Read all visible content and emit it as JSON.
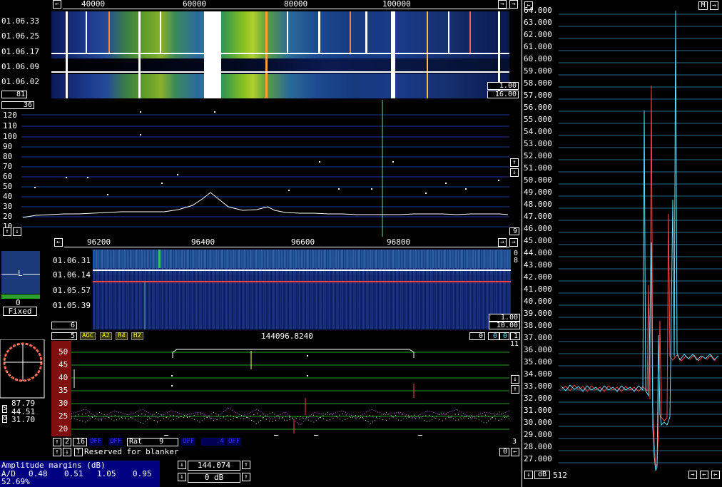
{
  "top_waterfall": {
    "freq_labels": [
      "40000",
      "60000",
      "80000",
      "100000"
    ],
    "time_labels": [
      "01.06.33",
      "01.06.25",
      "01.06.17",
      "01.06.09",
      "01.06.02"
    ],
    "left_box": "81",
    "right_box_1": "1.00",
    "right_box_2": "16.00"
  },
  "top_spectrum": {
    "top_left_box": "36",
    "y_labels": [
      "120",
      "110",
      "100",
      "90",
      "80",
      "70",
      "60",
      "50",
      "40",
      "30",
      "20",
      "10"
    ],
    "bottom_right_box": "9"
  },
  "small_rx": {
    "label_L": "L",
    "value": "0",
    "mode": "Fixed"
  },
  "mid_waterfall": {
    "freq_labels": [
      "96200",
      "96400",
      "96600",
      "96800"
    ],
    "time_labels": [
      "01.06.31",
      "01.06.14",
      "01.05.57",
      "01.05.39"
    ],
    "right_top_1": "0",
    "right_top_2": "8",
    "right_box_1": "1.00",
    "right_box_2": "10.00",
    "left_box": "6"
  },
  "baseband": {
    "left_box": "5",
    "tags": [
      "AGC",
      "A2",
      "R4",
      "H2"
    ],
    "frequency": "144096.8240",
    "right_boxes": [
      "0",
      "0",
      "0",
      "1"
    ],
    "right_num": "11",
    "y_labels": [
      "50",
      "45",
      "40",
      "35",
      "30",
      "25",
      "20"
    ],
    "row1_left": [
      "2",
      "16"
    ],
    "row1_tags": [
      "OFF",
      "OFF"
    ],
    "rat_label": "Rat",
    "rat_value": "9",
    "row1_tags2": [
      "OFF",
      "4",
      "OFF"
    ],
    "right_small": "3",
    "blanker_text": "Reserved for blanker",
    "bottom_right": "0"
  },
  "polar": {
    "s_value": "87.79",
    "mid_value": "44.51",
    "o_value": "31.70",
    "s_label": "S",
    "o_label": "o"
  },
  "status": {
    "line1": "Amplitude margins (dB)",
    "line2_label": "A/D",
    "ad_values": [
      "0.48",
      "0.51",
      "1.05",
      "0.95"
    ],
    "line3": "52.69%"
  },
  "freq_control": {
    "frequency": "144.074",
    "gain": "0 dB"
  },
  "right_panel": {
    "m_box": "M",
    "y_labels": [
      "64.000",
      "63.000",
      "62.000",
      "61.000",
      "60.000",
      "59.000",
      "58.000",
      "57.000",
      "56.000",
      "55.000",
      "54.000",
      "53.000",
      "52.000",
      "51.000",
      "50.000",
      "49.000",
      "48.000",
      "47.000",
      "46.000",
      "45.000",
      "44.000",
      "43.000",
      "42.000",
      "41.000",
      "40.000",
      "39.000",
      "38.000",
      "37.000",
      "36.000",
      "35.000",
      "34.000",
      "33.000",
      "32.000",
      "31.000",
      "30.000",
      "29.000",
      "28.000",
      "27.000"
    ],
    "bottom_unit": "dB",
    "bottom_value": "512"
  },
  "colors": {
    "grid_green": "#2a9c2a",
    "grid_blue": "#1a3c9c",
    "signal_cyan": "#5fe0ff",
    "signal_red": "#ff4040",
    "dark_red": "#801010"
  }
}
